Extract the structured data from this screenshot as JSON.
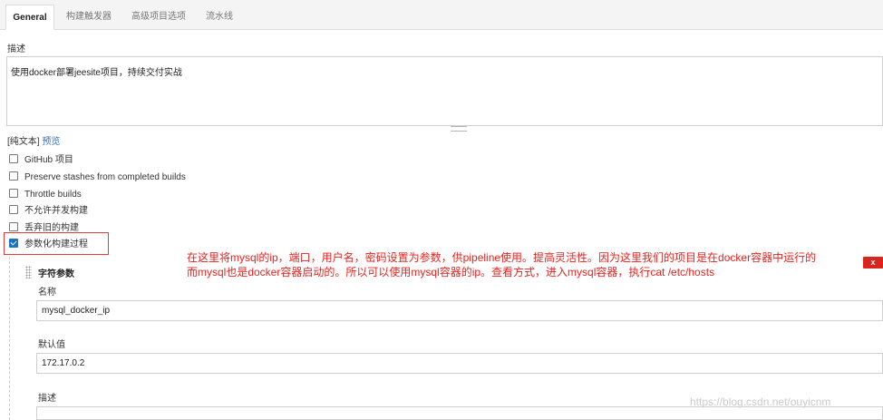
{
  "tabs": [
    {
      "label": "General",
      "active": true
    },
    {
      "label": "构建触发器",
      "active": false
    },
    {
      "label": "高级项目选项",
      "active": false
    },
    {
      "label": "流水线",
      "active": false
    }
  ],
  "description": {
    "label": "描述",
    "value": "使用docker部署jeesite项目，持续交付实战",
    "format_plain": "[纯文本]",
    "format_preview": "预览"
  },
  "options": [
    {
      "label": "GitHub 项目",
      "checked": false
    },
    {
      "label": "Preserve stashes from completed builds",
      "checked": false
    },
    {
      "label": "Throttle builds",
      "checked": false
    },
    {
      "label": "不允许并发构建",
      "checked": false
    },
    {
      "label": "丢弃旧的构建",
      "checked": false
    },
    {
      "label": "参数化构建过程",
      "checked": true
    }
  ],
  "param": {
    "title": "字符参数",
    "name_label": "名称",
    "name_value": "mysql_docker_ip",
    "default_label": "默认值",
    "default_value": "172.17.0.2",
    "desc_label": "描述"
  },
  "annotation": {
    "line1": "在这里将mysql的ip，端口，用户名，密码设置为参数，供pipeline使用。提高灵活性。因为这里我们的项目是在docker容器中运行的",
    "line2": "而mysql也是docker容器启动的。所以可以使用mysql容器的ip。查看方式，进入mysql容器，执行cat /etc/hosts",
    "color": "#e8231f"
  },
  "close_label": "x",
  "watermark": "https://blog.csdn.net/ouyicnm"
}
